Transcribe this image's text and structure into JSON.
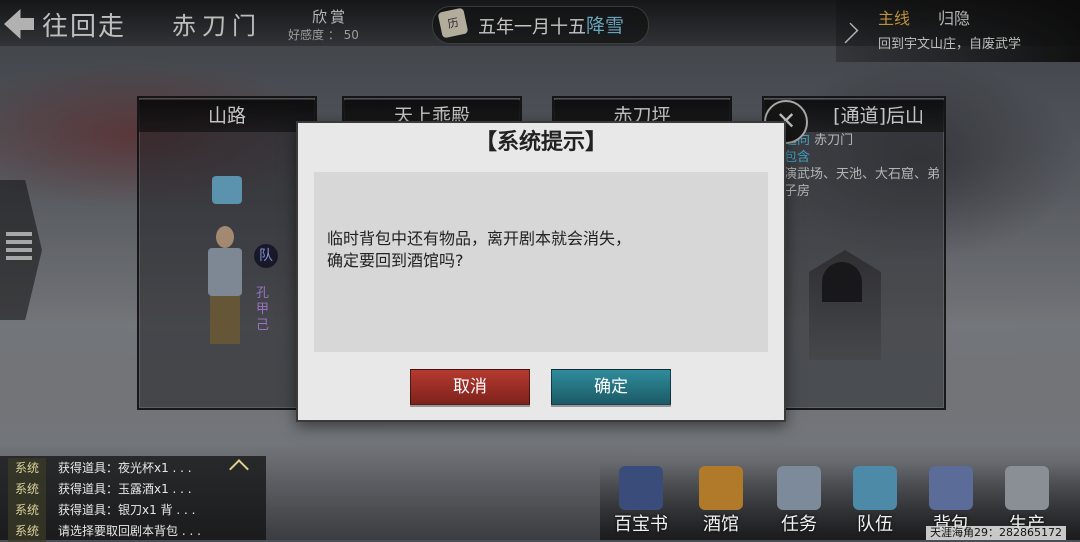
{
  "header": {
    "back_label": "往回走",
    "sect_name": "赤刀门",
    "relation": "欣賞",
    "favor": "好感度 ： 50",
    "date": "五年一月十五",
    "weather": "降雪",
    "calendar_glyph": "历"
  },
  "quest": {
    "tab_main": "主线",
    "tab_hide": "归隐",
    "description": "回到宇文山庄，自废武学"
  },
  "cards": [
    {
      "title": "山路"
    },
    {
      "title": "天上乖殿"
    },
    {
      "title": "赤刀坪"
    },
    {
      "title": "[通道]后山",
      "lead_label": "通向",
      "lead_value": "赤刀门",
      "contains_label": "包含",
      "contains_value": "演武场、天池、大石窟、弟子房"
    }
  ],
  "character": {
    "team_badge": "队",
    "name": "孔甲己"
  },
  "dialog": {
    "title": "【系统提示】",
    "message": "临时背包中还有物品，离开剧本就会消失，\n确定要回到酒馆吗?",
    "cancel_label": "取消",
    "confirm_label": "确定"
  },
  "log": [
    {
      "tag": "系统",
      "text": "获得道具：夜光杯x1 . . ."
    },
    {
      "tag": "系统",
      "text": "获得道具：玉露酒x1 . . ."
    },
    {
      "tag": "系统",
      "text": "获得道具：银刀x1  背 . . ."
    },
    {
      "tag": "系统",
      "text": "请选择要取回剧本背包 . . ."
    }
  ],
  "menu": [
    {
      "label": "百宝书",
      "icon": "book-icon"
    },
    {
      "label": "酒馆",
      "icon": "lantern-icon"
    },
    {
      "label": "任务",
      "icon": "scroll-icon"
    },
    {
      "label": "队伍",
      "icon": "flag-icon"
    },
    {
      "label": "背包",
      "icon": "bag-icon"
    },
    {
      "label": "生产",
      "icon": "anvil-icon"
    }
  ],
  "footer_id": "天涯海角29：282865172"
}
